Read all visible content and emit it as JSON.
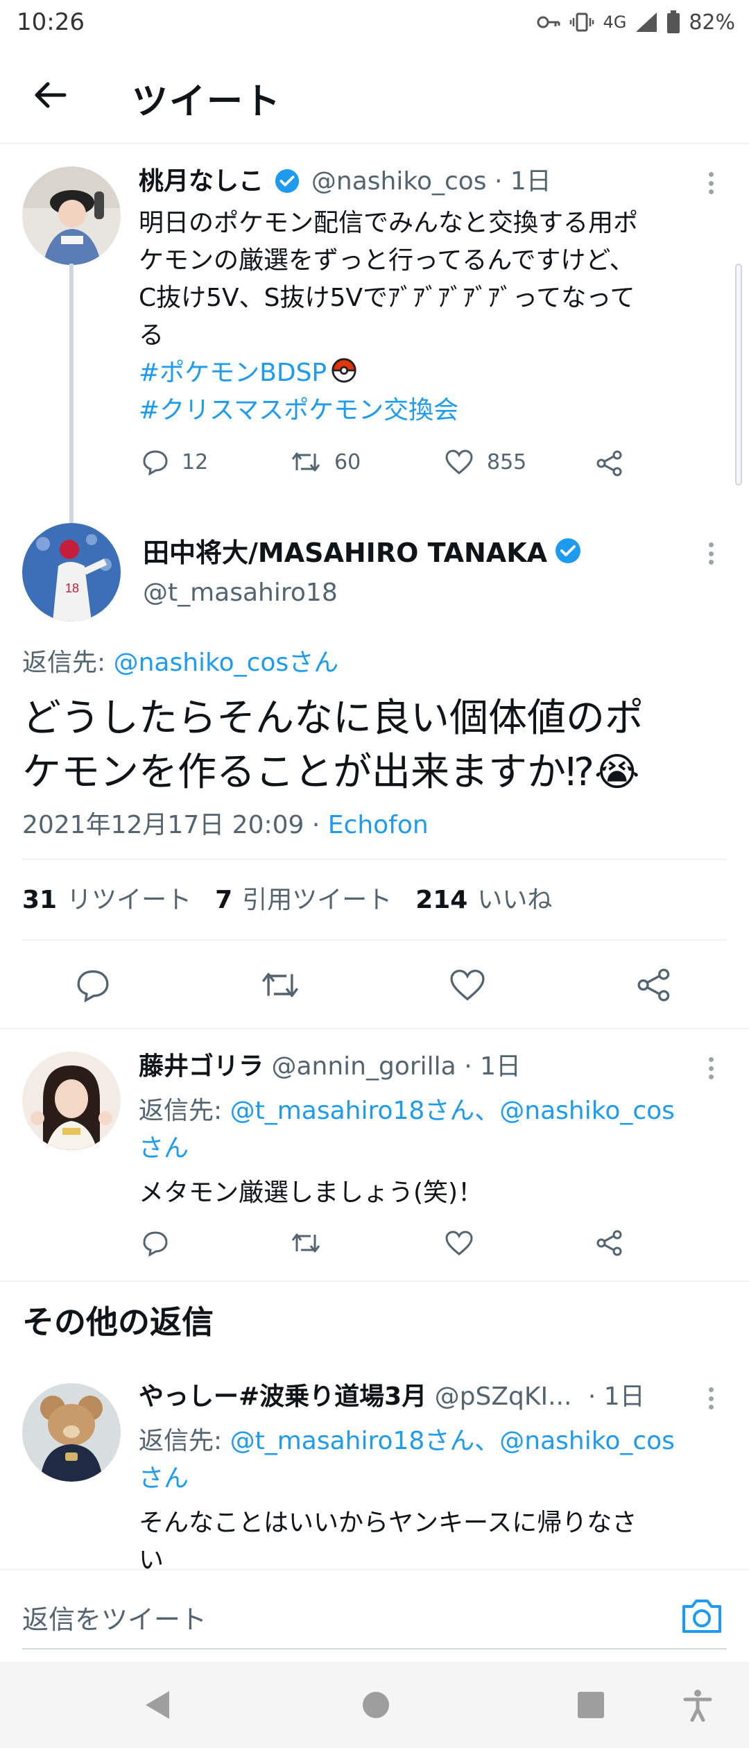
{
  "status_bar": {
    "time": "10:26",
    "network": "4G",
    "battery": "82%"
  },
  "header": {
    "title": "ツイート"
  },
  "parent_tweet": {
    "display_name": "桃月なしこ",
    "handle": "@nashiko_cos",
    "age": "· 1日",
    "text_lines": [
      "明日のポケモン配信でみんなと交換する用ポ",
      "ケモンの厳選をずっと行ってるんですけど、",
      "C抜け5V、S抜け5Vでｱﾞｱﾞｱﾞｱﾞｱﾞってなって",
      "る"
    ],
    "hashtags": [
      "#ポケモンBDSP",
      "#クリスマスポケモン交換会"
    ],
    "replies": "12",
    "retweets": "60",
    "likes": "855"
  },
  "main_tweet": {
    "display_name": "田中将大/MASAHIRO TANAKA",
    "handle": "@t_masahiro18",
    "reply_to_prefix": "返信先: ",
    "reply_to_handle": "@nashiko_cosさん",
    "text_lines": [
      "どうしたらそんなに良い個体値のポ",
      "ケモンを作ることが出来ますか⁉︎"
    ],
    "emoji": "😭",
    "date": "2021年12月17日 20:09",
    "separator": "·",
    "client": "Echofon",
    "stats": {
      "retweets_count": "31",
      "retweets_label": "リツイート",
      "quotes_count": "7",
      "quotes_label": "引用ツイート",
      "likes_count": "214",
      "likes_label": "いいね"
    }
  },
  "reply_1": {
    "display_name": "藤井ゴリラ",
    "handle": "@annin_gorilla",
    "age": "· 1日",
    "reply_to_prefix": "返信先: ",
    "reply_to_line1": "@t_masahiro18さん、@nashiko_cos",
    "reply_to_line2": "さん",
    "text": "メタモン厳選しましょう(笑)！"
  },
  "more_replies_title": "その他の返信",
  "reply_2": {
    "display_name": "やっしー#波乗り道場3月",
    "handle": "@pSZqKI...",
    "age": "· 1日",
    "reply_to_prefix": "返信先: ",
    "reply_to_line1": "@t_masahiro18さん、@nashiko_cos",
    "reply_to_line2": "さん",
    "text_line1": "そんなことはいいからヤンキースに帰りなさ",
    "text_line2": "い"
  },
  "reply_bar": {
    "placeholder": "返信をツイート"
  },
  "colors": {
    "link": "#1d9bf0",
    "text": "#0f1419",
    "secondary": "#536471",
    "verified": "#1d9bf0"
  }
}
